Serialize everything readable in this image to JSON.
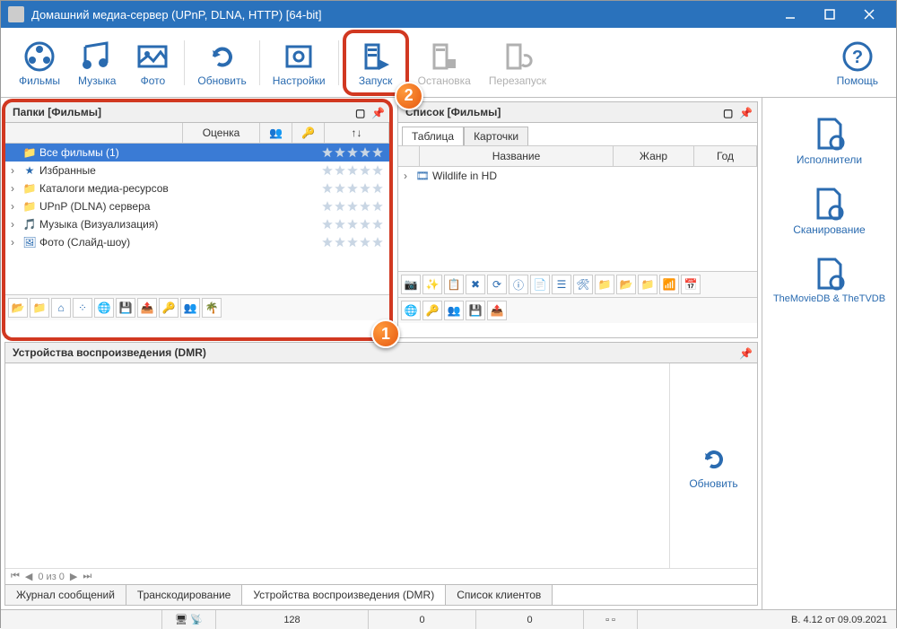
{
  "window": {
    "title": "Домашний медиа-сервер (UPnP, DLNA, HTTP) [64-bit]"
  },
  "toolbar": {
    "films": "Фильмы",
    "music": "Музыка",
    "photo": "Фото",
    "refresh": "Обновить",
    "settings": "Настройки",
    "start": "Запуск",
    "stop": "Остановка",
    "restart": "Перезапуск",
    "help": "Помощь"
  },
  "folders": {
    "title": "Папки [Фильмы]",
    "col_rating": "Оценка",
    "items": [
      {
        "name": "Все фильмы (1)",
        "selected": true,
        "icon": "folder"
      },
      {
        "name": "Избранные",
        "icon": "star"
      },
      {
        "name": "Каталоги медиа-ресурсов",
        "icon": "folder"
      },
      {
        "name": "UPnP (DLNA) сервера",
        "icon": "folder"
      },
      {
        "name": "Музыка (Визуализация)",
        "icon": "music"
      },
      {
        "name": "Фото (Слайд-шоу)",
        "icon": "photo"
      }
    ]
  },
  "list": {
    "title": "Список [Фильмы]",
    "tab_table": "Таблица",
    "tab_cards": "Карточки",
    "col_name": "Название",
    "col_genre": "Жанр",
    "col_year": "Год",
    "rows": [
      {
        "name": "Wildlife in HD"
      }
    ]
  },
  "dmr": {
    "title": "Устройства воспроизведения (DMR)",
    "refresh": "Обновить",
    "nav": "0 из 0"
  },
  "bottom_tabs": {
    "log": "Журнал сообщений",
    "transcode": "Транскодирование",
    "dmr": "Устройства воспроизведения (DMR)",
    "clients": "Список клиентов"
  },
  "sidebar": {
    "artists": "Исполнители",
    "scan": "Сканирование",
    "tmdb": "TheMovieDB & TheTVDB"
  },
  "status": {
    "v1": "128",
    "v2": "0",
    "v3": "0",
    "version": "В. 4.12 от 09.09.2021"
  },
  "badges": {
    "one": "1",
    "two": "2"
  }
}
